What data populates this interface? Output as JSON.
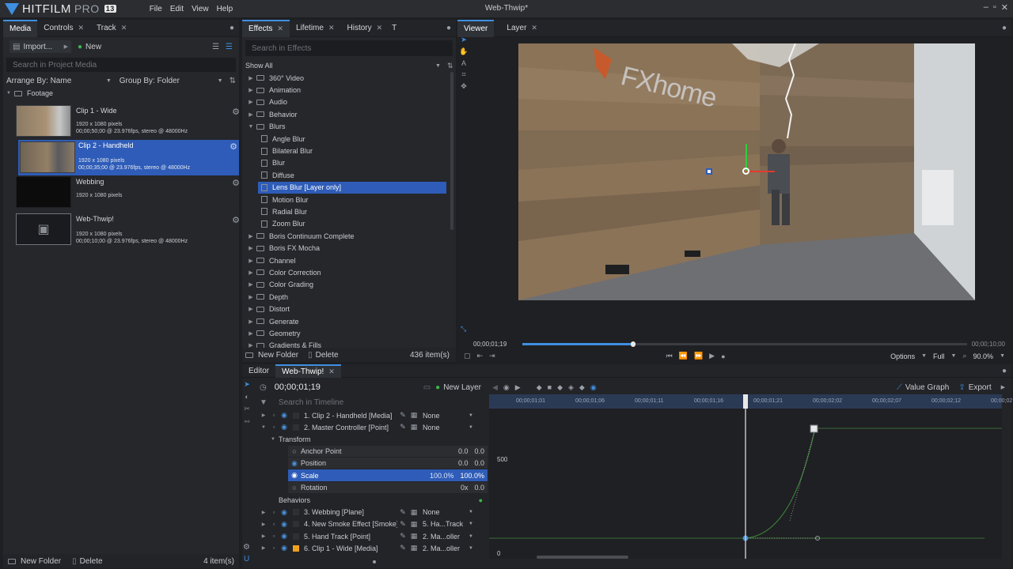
{
  "app": {
    "brand": "HITFILM",
    "edition": "PRO",
    "version": "13",
    "window_title": "Web-Thwip*"
  },
  "menu": [
    "File",
    "Edit",
    "View",
    "Help"
  ],
  "window_buttons": [
    "–",
    "▫",
    "✕"
  ],
  "media_panel": {
    "tabs": [
      "Media",
      "Controls",
      "Track"
    ],
    "import_label": "Import...",
    "new_label": "New",
    "search_placeholder": "Search in Project Media",
    "arrange_label": "Arrange By: Name",
    "group_label": "Group By: Folder",
    "folder_name": "Footage",
    "items": [
      {
        "name": "Clip 1 - Wide",
        "info": [
          "1920 x 1080 pixels",
          "00;00;50;00 @ 23.976fps, stereo @ 48000Hz"
        ]
      },
      {
        "name": "Clip 2 - Handheld",
        "info": [
          "1920 x 1080 pixels",
          "00;00;35;00 @ 23.976fps, stereo @ 48000Hz"
        ]
      },
      {
        "name": "Webbing",
        "info": [
          "1920 x 1080 pixels"
        ]
      },
      {
        "name": "Web-Thwip!",
        "info": [
          "1920 x 1080 pixels",
          "00;00;10;00 @ 23.976fps, stereo @ 48000Hz"
        ]
      }
    ],
    "footer_new_folder": "New Folder",
    "footer_delete": "Delete",
    "footer_count": "4 item(s)"
  },
  "effects_panel": {
    "tabs": [
      "Effects",
      "Lifetime",
      "History",
      "T"
    ],
    "search_placeholder": "Search in Effects",
    "filter_label": "Show All",
    "items": [
      {
        "label": "360° Video",
        "type": "folder",
        "indent": 0
      },
      {
        "label": "Animation",
        "type": "folder",
        "indent": 0
      },
      {
        "label": "Audio",
        "type": "folder",
        "indent": 0
      },
      {
        "label": "Behavior",
        "type": "folder",
        "indent": 0
      },
      {
        "label": "Blurs",
        "type": "folder-open",
        "indent": 0
      },
      {
        "label": "Angle Blur",
        "type": "effect",
        "indent": 1
      },
      {
        "label": "Bilateral Blur",
        "type": "effect",
        "indent": 1
      },
      {
        "label": "Blur",
        "type": "effect",
        "indent": 1
      },
      {
        "label": "Diffuse",
        "type": "effect",
        "indent": 1
      },
      {
        "label": "Lens Blur [Layer only]",
        "type": "effect",
        "indent": 1,
        "selected": true
      },
      {
        "label": "Motion Blur",
        "type": "effect",
        "indent": 1
      },
      {
        "label": "Radial Blur",
        "type": "effect",
        "indent": 1
      },
      {
        "label": "Zoom Blur",
        "type": "effect",
        "indent": 1
      },
      {
        "label": "Boris Continuum Complete",
        "type": "folder",
        "indent": 0
      },
      {
        "label": "Boris FX Mocha",
        "type": "folder",
        "indent": 0
      },
      {
        "label": "Channel",
        "type": "folder",
        "indent": 0
      },
      {
        "label": "Color Correction",
        "type": "folder",
        "indent": 0
      },
      {
        "label": "Color Grading",
        "type": "folder",
        "indent": 0
      },
      {
        "label": "Depth",
        "type": "folder",
        "indent": 0
      },
      {
        "label": "Distort",
        "type": "folder",
        "indent": 0
      },
      {
        "label": "Generate",
        "type": "folder",
        "indent": 0
      },
      {
        "label": "Geometry",
        "type": "folder",
        "indent": 0
      },
      {
        "label": "Gradients & Fills",
        "type": "folder",
        "indent": 0
      }
    ],
    "footer_new_folder": "New Folder",
    "footer_delete": "Delete",
    "footer_count": "436 item(s)"
  },
  "viewer_panel": {
    "tabs": [
      "Viewer",
      "Layer"
    ],
    "time_start": "00;00;01;19",
    "time_end": "00;00;10;00",
    "playhead_fraction": 0.25,
    "options_label": "Options",
    "quality_label": "Full",
    "zoom_label": "90.0%",
    "image_text": "FXhome"
  },
  "editor_panel": {
    "tabs": [
      "Editor",
      "Web-Thwip!"
    ],
    "timecode": "00;00;01;19",
    "new_layer_label": "New Layer",
    "value_graph_label": "Value Graph",
    "export_label": "Export",
    "search_placeholder": "Search in Timeline",
    "ruler_ticks": [
      "00;00;01;01",
      "00;00;01;06",
      "00;00;01;11",
      "00;00;01;16",
      "00;00;01;21",
      "00;00;02;02",
      "00;00;02;07",
      "00;00;02;12",
      "00;00;02"
    ],
    "graph_label_500": "500",
    "graph_label_0": "0",
    "layers": [
      {
        "label": "1. Clip 2 - Handheld [Media]",
        "parent": "None",
        "indent": 0,
        "kind": "layer"
      },
      {
        "label": "2. Master Controller [Point]",
        "parent": "None",
        "indent": 0,
        "kind": "layer",
        "expanded": true
      },
      {
        "label": "Transform",
        "kind": "group"
      },
      {
        "label": "Anchor Point",
        "kind": "prop",
        "v1": "0.0",
        "v2": "0.0"
      },
      {
        "label": "Position",
        "kind": "prop",
        "v1": "0.0",
        "v2": "0.0",
        "keyed": true
      },
      {
        "label": "Scale",
        "kind": "prop",
        "v1": "100.0%",
        "v2": "100.0%",
        "keyed": true,
        "selected": true
      },
      {
        "label": "Rotation",
        "kind": "prop",
        "v1": "0x",
        "v2": "0.0"
      },
      {
        "label": "Behaviors",
        "kind": "group2"
      },
      {
        "label": "3. Webbing [Plane]",
        "parent": "None",
        "kind": "layer"
      },
      {
        "label": "4. New Smoke Effect [Smoke]",
        "parent": "5. Ha...Track",
        "kind": "layer"
      },
      {
        "label": "5. Hand Track [Point]",
        "parent": "2. Ma...oller",
        "kind": "layer"
      },
      {
        "label": "6. Clip 1 - Wide [Media]",
        "parent": "2. Ma...oller",
        "kind": "layer",
        "orange": true
      }
    ]
  }
}
